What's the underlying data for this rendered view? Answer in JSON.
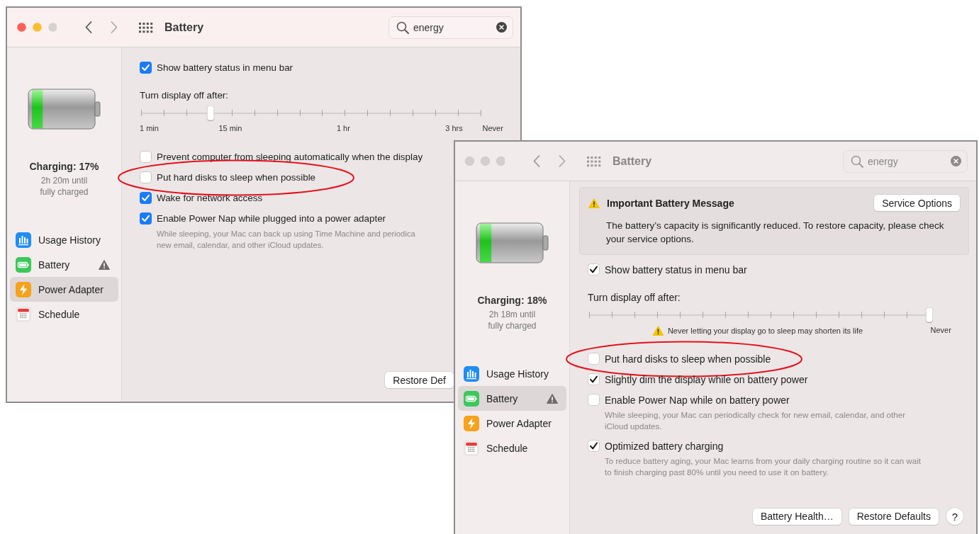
{
  "windows": [
    {
      "focused": true,
      "title": "Battery",
      "search": "energy",
      "battery": {
        "level": 0.17,
        "status": "Charging: 17%",
        "detail": "2h 20m until fully charged"
      },
      "sidebar": [
        {
          "label": "Usage History",
          "kind": "usage",
          "warning": false,
          "selected": false
        },
        {
          "label": "Battery",
          "kind": "battery",
          "warning": true,
          "selected": false
        },
        {
          "label": "Power Adapter",
          "kind": "power",
          "warning": false,
          "selected": true
        },
        {
          "label": "Schedule",
          "kind": "schedule",
          "warning": false,
          "selected": false
        }
      ],
      "content": [
        {
          "kind": "checkbox",
          "label": "Show battery status in menu bar",
          "checked": true,
          "circled": false
        },
        {
          "kind": "slider",
          "label": "Turn display off after:",
          "level": 0.205,
          "ticks": [
            "1 min",
            "15 min",
            "1 hr",
            "3 hrs",
            "Never"
          ]
        },
        {
          "kind": "checkbox",
          "label": "Prevent computer from sleeping automatically when the display",
          "checked": false,
          "circled": false
        },
        {
          "kind": "checkbox",
          "label": "Put hard disks to sleep when possible",
          "checked": false,
          "circled": true
        },
        {
          "kind": "checkbox",
          "label": "Wake for network access",
          "checked": true,
          "circled": false
        },
        {
          "kind": "checkbox",
          "label": "Enable Power Nap while plugged into a power adapter",
          "checked": true,
          "circled": false,
          "note": [
            "While sleeping, your Mac can back up using Time Machine and periodica",
            "new email, calendar, and other iCloud updates."
          ]
        }
      ],
      "buttons": [
        "Restore Def"
      ]
    },
    {
      "focused": false,
      "title": "Battery",
      "search": "energy",
      "battery": {
        "level": 0.18,
        "status": "Charging: 18%",
        "detail": "2h 18m until fully charged"
      },
      "sidebar": [
        {
          "label": "Usage History",
          "kind": "usage",
          "warning": false,
          "selected": false
        },
        {
          "label": "Battery",
          "kind": "battery",
          "warning": true,
          "selected": true
        },
        {
          "label": "Power Adapter",
          "kind": "power",
          "warning": false,
          "selected": false
        },
        {
          "label": "Schedule",
          "kind": "schedule",
          "warning": false,
          "selected": false
        }
      ],
      "content": [
        {
          "kind": "message",
          "title": "Important Battery Message",
          "button": "Service Options",
          "text": "The battery’s capacity is significantly reduced. To restore capacity, please check your service options."
        },
        {
          "kind": "checkbox",
          "label": "Show battery status in menu bar",
          "checked": true,
          "circled": false
        },
        {
          "kind": "slider",
          "label": "Turn display off after:",
          "level": 1,
          "warning": "Never letting your display go to sleep may shorten its life",
          "ticks": [
            "Never"
          ]
        },
        {
          "kind": "checkbox",
          "label": "Put hard disks to sleep when possible",
          "checked": false,
          "circled": true
        },
        {
          "kind": "checkbox",
          "label": "Slightly dim the display while on battery power",
          "checked": true,
          "circled": false
        },
        {
          "kind": "checkbox",
          "label": "Enable Power Nap while on battery power",
          "checked": false,
          "circled": false,
          "note": [
            "While sleeping, your Mac can periodically check for new email, calendar, and other",
            "iCloud updates."
          ]
        },
        {
          "kind": "checkbox",
          "label": "Optimized battery charging",
          "checked": true,
          "circled": false,
          "note": [
            "To reduce battery aging, your Mac learns from your daily charging routine so it can wait",
            "to finish charging past 80% until you need to use it on battery."
          ]
        }
      ],
      "buttons": [
        "Battery Health…",
        "Restore Defaults"
      ],
      "help": "?"
    }
  ]
}
